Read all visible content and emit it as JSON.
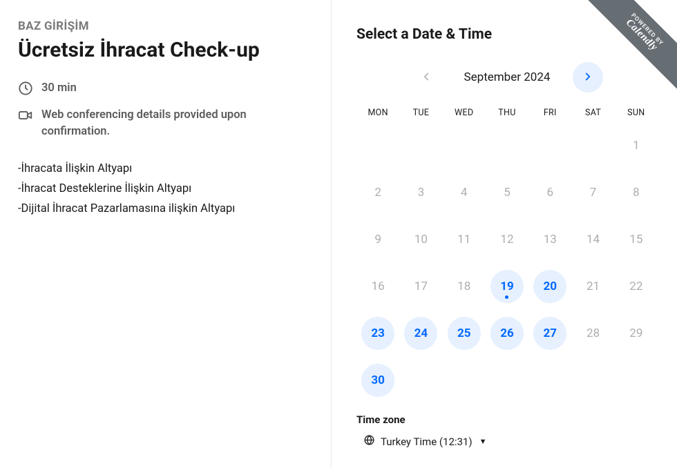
{
  "left": {
    "host": "BAZ GİRİŞİM",
    "title": "Ücretsiz İhracat Check-up",
    "duration": "30 min",
    "conferencing": "Web conferencing details provided upon confirmation.",
    "desc_lines": [
      "-İhracata İlişkin Altyapı",
      "-İhracat Desteklerine İlişkin Altyapı",
      "-Dijital İhracat Pazarlamasına ilişkin Altyapı"
    ]
  },
  "right": {
    "heading": "Select a Date & Time",
    "month_label": "September 2024",
    "weekdays": [
      "MON",
      "TUE",
      "WED",
      "THU",
      "FRI",
      "SAT",
      "SUN"
    ],
    "days": [
      {
        "n": "",
        "type": "empty"
      },
      {
        "n": "",
        "type": "empty"
      },
      {
        "n": "",
        "type": "empty"
      },
      {
        "n": "",
        "type": "empty"
      },
      {
        "n": "",
        "type": "empty"
      },
      {
        "n": "",
        "type": "empty"
      },
      {
        "n": "1",
        "type": "unavail"
      },
      {
        "n": "2",
        "type": "unavail"
      },
      {
        "n": "3",
        "type": "unavail"
      },
      {
        "n": "4",
        "type": "unavail"
      },
      {
        "n": "5",
        "type": "unavail"
      },
      {
        "n": "6",
        "type": "unavail"
      },
      {
        "n": "7",
        "type": "unavail"
      },
      {
        "n": "8",
        "type": "unavail"
      },
      {
        "n": "9",
        "type": "unavail"
      },
      {
        "n": "10",
        "type": "unavail"
      },
      {
        "n": "11",
        "type": "unavail"
      },
      {
        "n": "12",
        "type": "unavail"
      },
      {
        "n": "13",
        "type": "unavail"
      },
      {
        "n": "14",
        "type": "unavail"
      },
      {
        "n": "15",
        "type": "unavail"
      },
      {
        "n": "16",
        "type": "unavail"
      },
      {
        "n": "17",
        "type": "unavail"
      },
      {
        "n": "18",
        "type": "unavail"
      },
      {
        "n": "19",
        "type": "avail",
        "today": true
      },
      {
        "n": "20",
        "type": "avail"
      },
      {
        "n": "21",
        "type": "unavail"
      },
      {
        "n": "22",
        "type": "unavail"
      },
      {
        "n": "23",
        "type": "avail"
      },
      {
        "n": "24",
        "type": "avail"
      },
      {
        "n": "25",
        "type": "avail"
      },
      {
        "n": "26",
        "type": "avail"
      },
      {
        "n": "27",
        "type": "avail"
      },
      {
        "n": "28",
        "type": "unavail"
      },
      {
        "n": "29",
        "type": "unavail"
      },
      {
        "n": "30",
        "type": "avail"
      }
    ],
    "tz_label": "Time zone",
    "tz_value": "Turkey Time (12:31)"
  },
  "ribbon": {
    "powered": "POWERED BY",
    "brand": "Calendly"
  }
}
